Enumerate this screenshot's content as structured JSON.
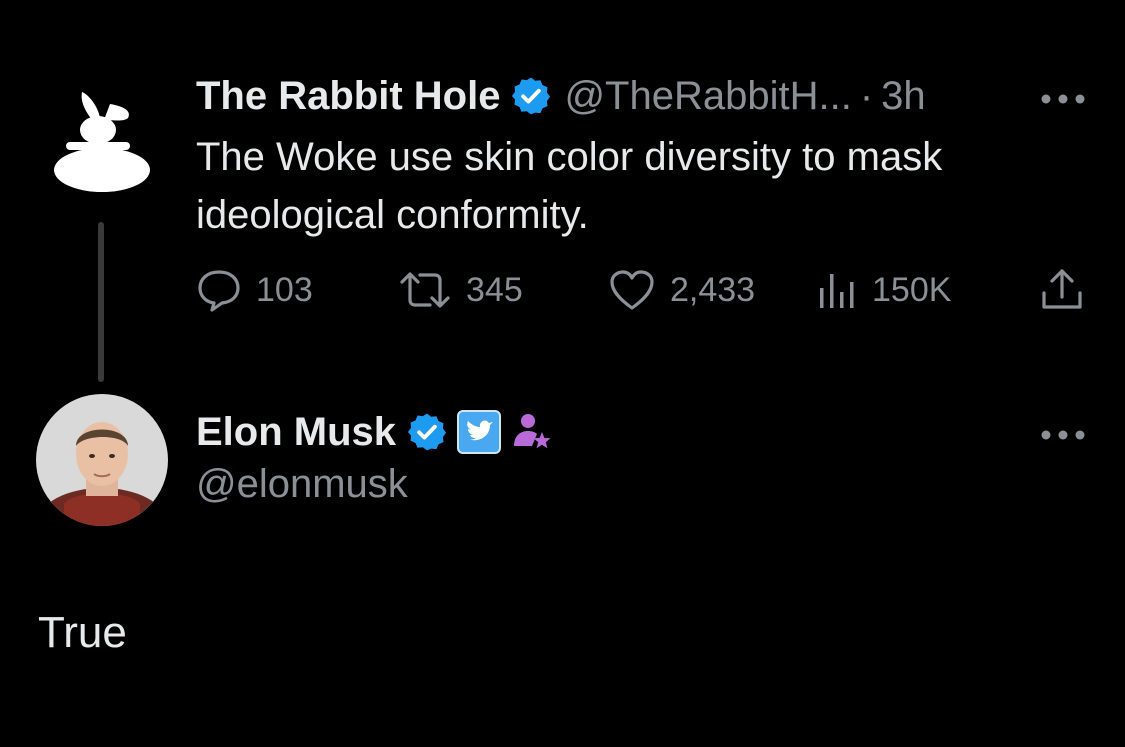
{
  "parent_tweet": {
    "author_name": "The Rabbit Hole",
    "handle": "@TheRabbitH...",
    "separator": "·",
    "time": "3h",
    "text": "The Woke use skin color diversity to mask ideological conformity.",
    "actions": {
      "replies": "103",
      "retweets": "345",
      "likes": "2,433",
      "views": "150K"
    },
    "avatar_icon": "rabbit-logo-icon"
  },
  "reply": {
    "author_name": "Elon Musk",
    "handle": "@elonmusk",
    "text": "True",
    "badges": [
      "verified-badge-icon",
      "twitter-badge-icon",
      "affiliate-person-icon"
    ]
  },
  "colors": {
    "background": "#000000",
    "primary_text": "#e7e9ea",
    "secondary_text": "#8b9097",
    "verified_blue": "#1d9bf0",
    "affiliate_purple": "#b86bd8"
  }
}
